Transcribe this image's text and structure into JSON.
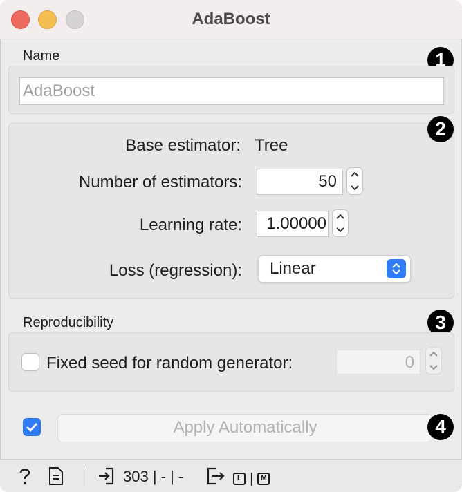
{
  "window": {
    "title": "AdaBoost"
  },
  "sections": {
    "name": {
      "label": "Name",
      "badge": "1",
      "input_value": "AdaBoost"
    },
    "params": {
      "badge": "2",
      "base_estimator_label": "Base estimator:",
      "base_estimator_value": "Tree",
      "n_estimators_label": "Number of estimators:",
      "n_estimators_value": "50",
      "learning_rate_label": "Learning rate:",
      "learning_rate_value": "1.00000",
      "loss_label": "Loss (regression):",
      "loss_value": "Linear"
    },
    "reproducibility": {
      "label": "Reproducibility",
      "badge": "3",
      "fixed_seed_label": "Fixed seed for random generator:",
      "seed_value": "0",
      "fixed_seed_checked": false
    },
    "apply": {
      "badge": "4",
      "button_label": "Apply Automatically",
      "auto_checked": true
    }
  },
  "statusbar": {
    "input_summary": "303 | - | -",
    "output_l": "L",
    "output_sep": "|",
    "output_m": "M"
  },
  "colors": {
    "accent": "#2f7cf6",
    "close": "#ed6a5e",
    "minimize": "#f4bf4f",
    "zoom_disabled": "#d6d3d3"
  },
  "icons": [
    "question-icon",
    "report-icon",
    "input-icon",
    "output-icon",
    "chevron-up-icon",
    "chevron-down-icon",
    "updown-arrows-icon",
    "checkmark-icon"
  ]
}
